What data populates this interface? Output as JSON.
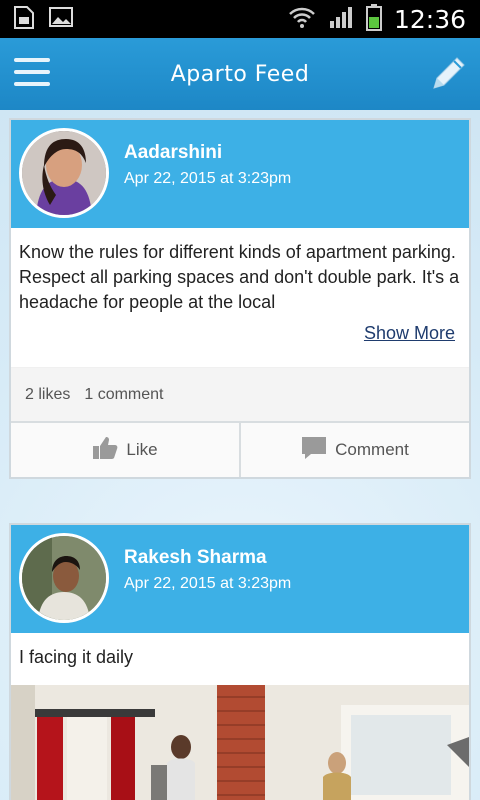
{
  "status_bar": {
    "time": "12:36"
  },
  "app_bar": {
    "title": "Aparto Feed"
  },
  "posts": [
    {
      "author": "Aadarshini",
      "date": "Apr 22, 2015 at 3:23pm",
      "body": "Know the rules for different kinds of apartment parking. Respect all parking spaces and don't double park. It's a headache for people at the local",
      "show_more": "Show More",
      "likes": "2 likes",
      "comments": "1 comment",
      "like_label": "Like",
      "comment_label": "Comment"
    },
    {
      "author": "Rakesh Sharma",
      "date": "Apr 22, 2015 at 3:23pm",
      "body": "I facing it daily"
    }
  ]
}
